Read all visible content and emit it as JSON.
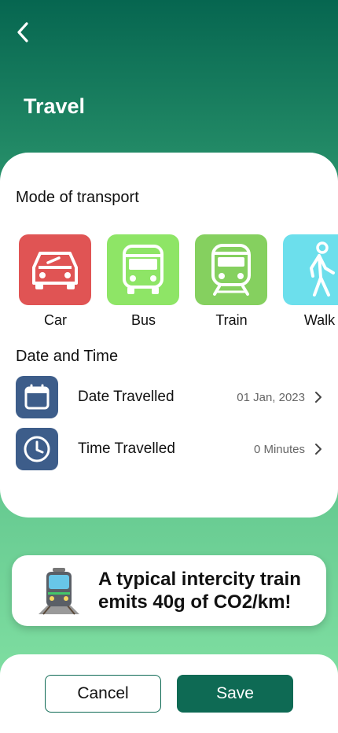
{
  "header": {
    "back_icon": "chevron-left-icon",
    "title": "Travel"
  },
  "transport": {
    "section_title": "Mode of transport",
    "modes": [
      {
        "label": "Car",
        "icon": "car-icon",
        "color": "#e05454"
      },
      {
        "label": "Bus",
        "icon": "bus-icon",
        "color": "#8ee566"
      },
      {
        "label": "Train",
        "icon": "train-icon",
        "color": "#85d05f"
      },
      {
        "label": "Walk",
        "icon": "walk-icon",
        "color": "#6cdfec"
      }
    ]
  },
  "datetime": {
    "section_title": "Date and Time",
    "date_row": {
      "label": "Date Travelled",
      "value": "01 Jan, 2023",
      "icon": "calendar-icon"
    },
    "time_row": {
      "label": "Time Travelled",
      "value": "0 Minutes",
      "icon": "clock-icon"
    },
    "icon_color": "#3d5d8a"
  },
  "tip": {
    "icon": "tram-icon",
    "line1": "A typical intercity train",
    "line2": "emits 40g of CO2/km!"
  },
  "footer": {
    "cancel_label": "Cancel",
    "save_label": "Save",
    "accent": "#0e6a54"
  }
}
